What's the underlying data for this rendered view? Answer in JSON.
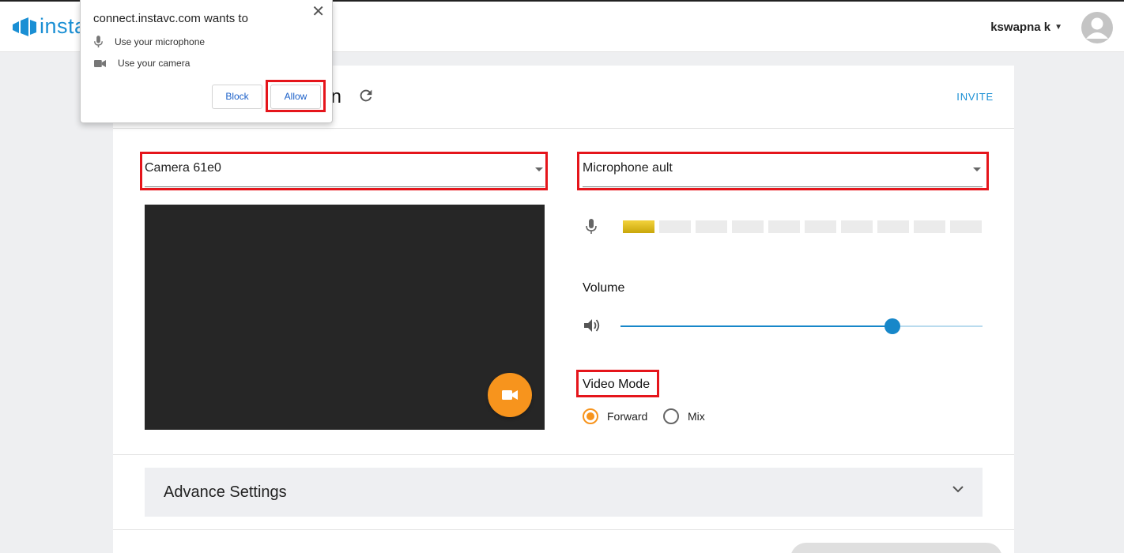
{
  "app": {
    "logo_text": "insta",
    "user_name": "kswapna k",
    "heading_partial": "n",
    "invite_label": "INVITE"
  },
  "devices": {
    "camera_selected": "Camera 61e0",
    "microphone_selected": "Microphone ault"
  },
  "mic_meter": {
    "level": 1,
    "segments": 10
  },
  "volume": {
    "label": "Volume",
    "value_fraction": 0.75
  },
  "video_mode": {
    "label": "Video Mode",
    "options": [
      "Forward",
      "Mix"
    ],
    "selected": "Forward"
  },
  "advance_settings": {
    "label": "Advance Settings"
  },
  "permission_prompt": {
    "title": "connect.instavc.com wants to",
    "items": [
      "Use your microphone",
      "Use your camera"
    ],
    "block_label": "Block",
    "allow_label": "Allow",
    "close_glyph": "✕"
  },
  "colors": {
    "accent_blue": "#1a8fd4",
    "slider_blue": "#1787c9",
    "camera_button_orange": "#f7941d",
    "highlight_red": "#e5151b",
    "meter_active": "#e0bd14"
  },
  "icons": [
    "instavc-logo-icon",
    "refresh-icon",
    "microphone-icon",
    "speaker-icon",
    "video-camera-icon",
    "chevron-down-icon",
    "close-icon",
    "avatar-icon"
  ]
}
